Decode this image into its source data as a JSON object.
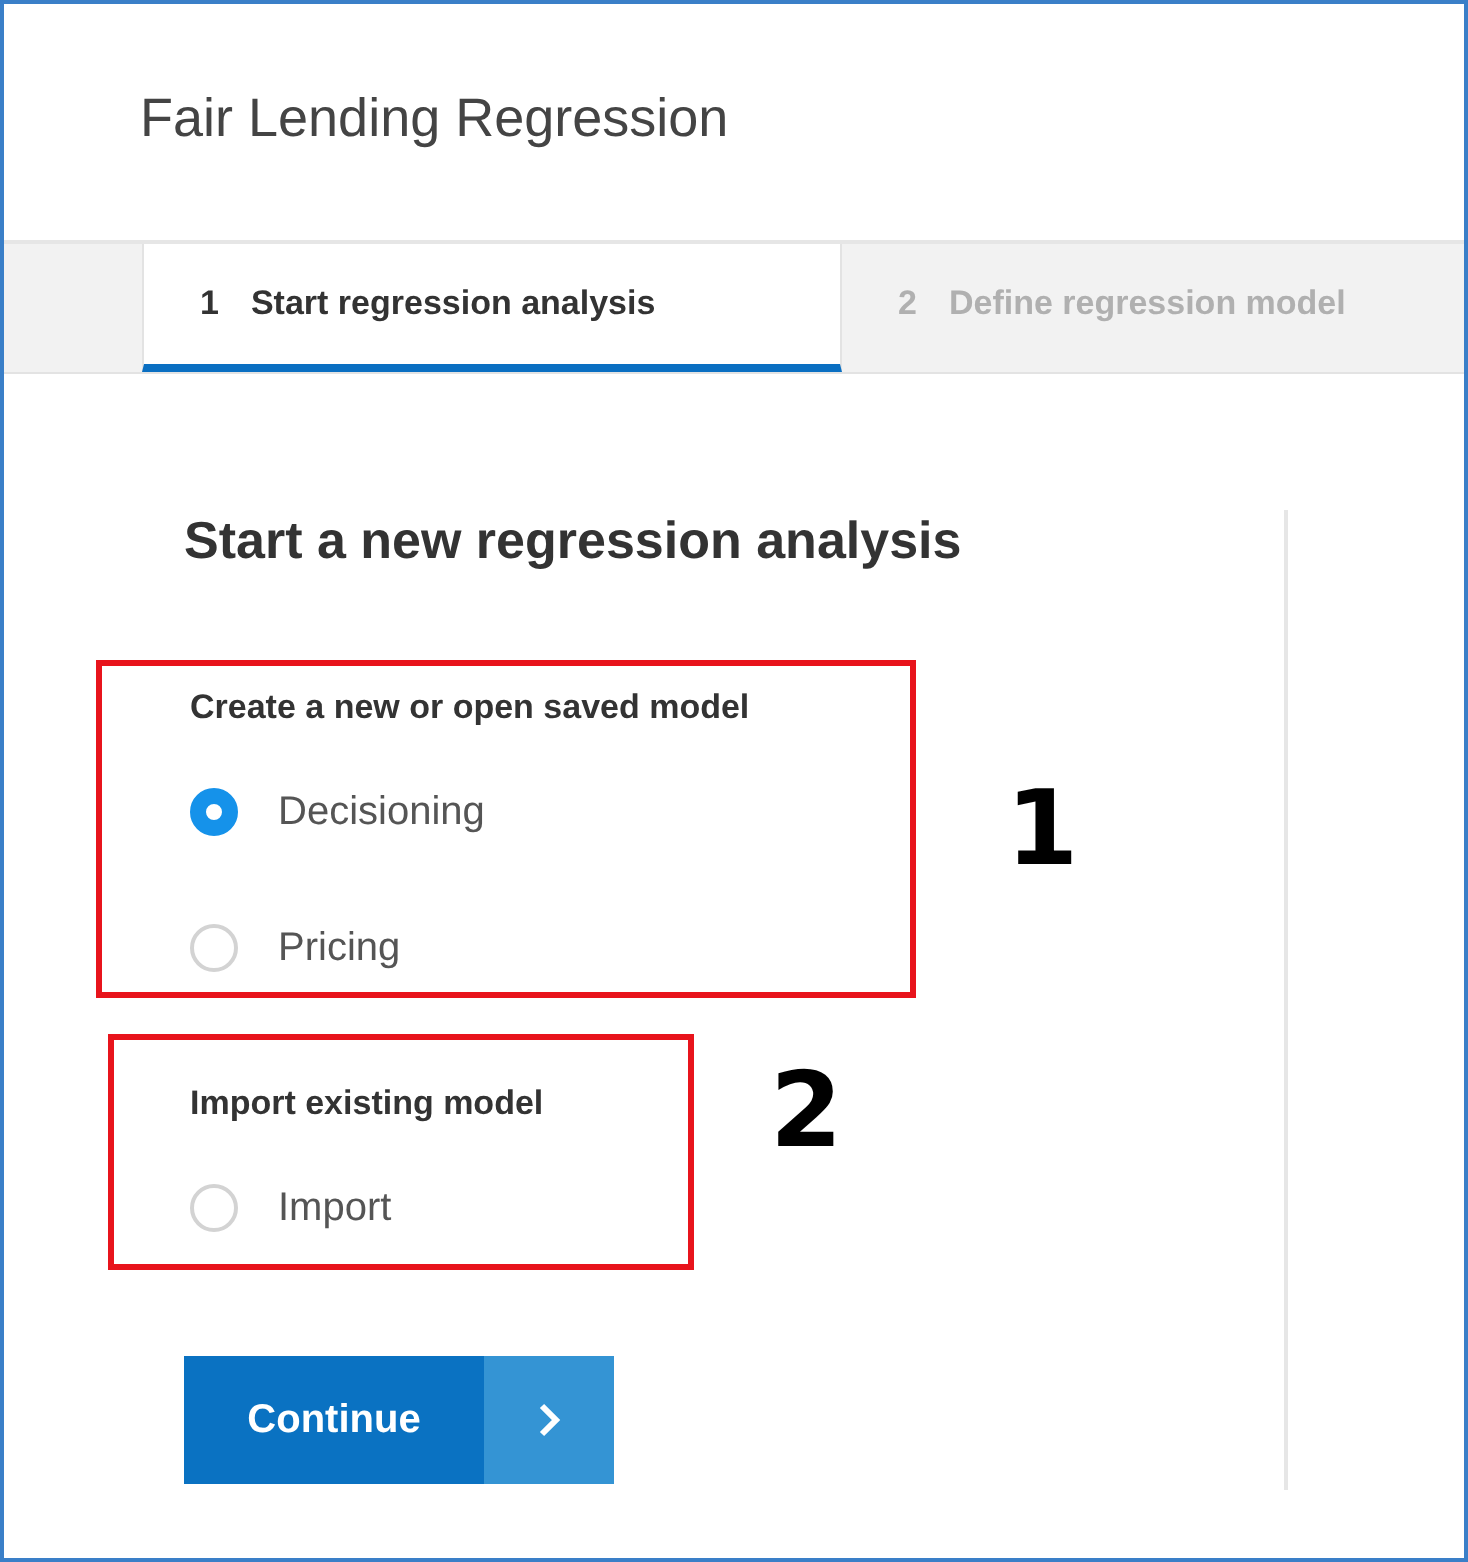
{
  "window": {
    "title": "Fair Lending Regression"
  },
  "steps": [
    {
      "number": "1",
      "label": "Start regression analysis",
      "selected": true
    },
    {
      "number": "2",
      "label": "Define regression model",
      "selected": false
    }
  ],
  "heading": "Start a new regression analysis",
  "groups": [
    {
      "label": "Create a new or open saved model",
      "callout": "1",
      "options": [
        {
          "label": "Decisioning",
          "selected": true
        },
        {
          "label": "Pricing",
          "selected": false
        }
      ]
    },
    {
      "label": "Import existing model",
      "callout": "2",
      "options": [
        {
          "label": "Import",
          "selected": false
        }
      ]
    }
  ],
  "continue_button": {
    "label": "Continue"
  }
}
